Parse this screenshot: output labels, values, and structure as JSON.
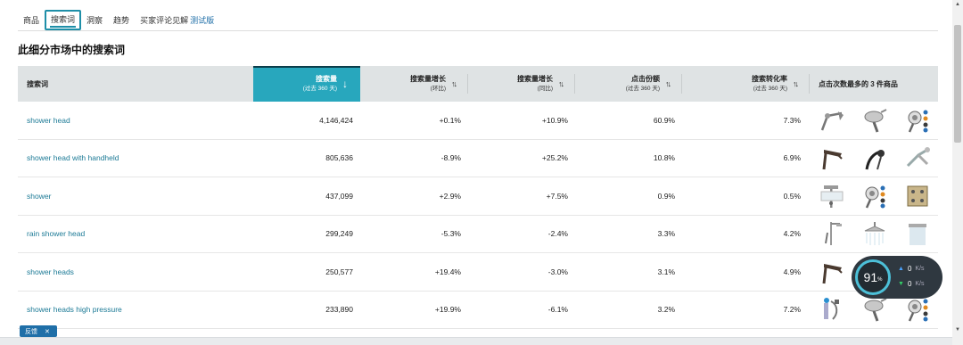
{
  "tabs": [
    {
      "label": "商品"
    },
    {
      "label": "搜索词",
      "active": true
    },
    {
      "label": "洞察"
    },
    {
      "label": "趋势"
    },
    {
      "label": "买家评论见解",
      "badge": "测试版"
    }
  ],
  "page_title": "此细分市场中的搜索词",
  "columns": [
    {
      "label": "搜索词",
      "sub": ""
    },
    {
      "label": "搜索量",
      "sub": "(过去 360 天)",
      "sort": "↓",
      "selected": true
    },
    {
      "label": "搜索量增长",
      "sub": "(环比)",
      "sort": "↑↓"
    },
    {
      "label": "搜索量增长",
      "sub": "(同比)",
      "sort": "↑↓"
    },
    {
      "label": "点击份额",
      "sub": "(过去 360 天)",
      "sort": "↑↓"
    },
    {
      "label": "搜索转化率",
      "sub": "(过去 360 天)",
      "sort": "↑↓"
    },
    {
      "label": "点击次数最多的 3 件商品",
      "sub": ""
    }
  ],
  "rows": [
    {
      "term": "shower head",
      "volume": "4,146,424",
      "growth_mom": "+0.1%",
      "growth_yoy": "+10.9%",
      "click_share": "60.9%",
      "conversion": "7.3%",
      "products": [
        "shower-arm-product",
        "round-shower-head-product",
        "multi-setting-shower-head-product"
      ]
    },
    {
      "term": "shower head with handheld",
      "volume": "805,636",
      "growth_mom": "-8.9%",
      "growth_yoy": "+25.2%",
      "click_share": "10.8%",
      "conversion": "6.9%",
      "products": [
        "bronze-shower-head-product",
        "black-handheld-shower-product",
        "chrome-dual-shower-product"
      ]
    },
    {
      "term": "shower",
      "volume": "437,099",
      "growth_mom": "+2.9%",
      "growth_yoy": "+7.5%",
      "click_share": "0.9%",
      "conversion": "0.5%",
      "products": [
        "shower-system-product",
        "multi-setting-shower-head-product",
        "shower-panel-product"
      ]
    },
    {
      "term": "rain shower head",
      "volume": "299,249",
      "growth_mom": "-5.3%",
      "growth_yoy": "-2.4%",
      "click_share": "3.3%",
      "conversion": "4.2%",
      "products": [
        "slide-bar-shower-product",
        "rain-shower-head-product",
        "square-rain-shower-product"
      ]
    },
    {
      "term": "shower heads",
      "volume": "250,577",
      "growth_mom": "+19.4%",
      "growth_yoy": "-3.0%",
      "click_share": "3.1%",
      "conversion": "4.9%",
      "products": [
        "bronze-shower-head-product",
        "round-shower-head-product",
        "multi-setting-shower-head-product"
      ]
    },
    {
      "term": "shower heads high pressure",
      "volume": "233,890",
      "growth_mom": "+19.9%",
      "growth_yoy": "-6.1%",
      "click_share": "3.2%",
      "conversion": "7.2%",
      "products": [
        "filter-shower-product",
        "round-shower-head-product",
        "multi-setting-shower-head-product"
      ]
    }
  ],
  "feedback": {
    "label": "反馈",
    "close": "✕"
  },
  "network_widget": {
    "percent": "91",
    "percent_unit": "%",
    "up_value": "0",
    "down_value": "0",
    "unit": "K/s"
  },
  "colors": {
    "accent": "#28a7bd",
    "link": "#1c7a96",
    "header_bg": "#dfe3e4"
  }
}
